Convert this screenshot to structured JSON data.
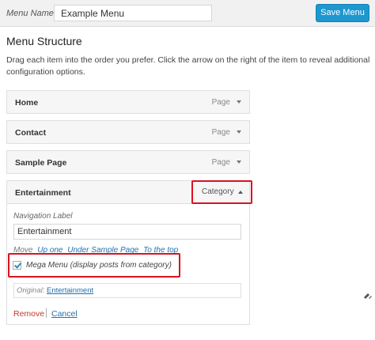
{
  "header": {
    "menu_name_label": "Menu Name",
    "menu_name_value": "Example Menu",
    "save_label": "Save Menu"
  },
  "structure": {
    "heading": "Menu Structure",
    "instructions": "Drag each item into the order you prefer. Click the arrow on the right of the item to reveal additional configuration options."
  },
  "items": [
    {
      "title": "Home",
      "type": "Page"
    },
    {
      "title": "Contact",
      "type": "Page"
    },
    {
      "title": "Sample Page",
      "type": "Page"
    },
    {
      "title": "Entertainment",
      "type": "Category"
    }
  ],
  "expanded": {
    "nav_label": "Navigation Label",
    "nav_value": "Entertainment",
    "move_label": "Move",
    "move_links": [
      "Up one",
      "Under Sample Page",
      "To the top"
    ],
    "mega_menu_label": "Mega Menu (display posts from category)",
    "mega_menu_checked": true,
    "original_label": "Original:",
    "original_link": "Entertainment",
    "remove_label": "Remove",
    "cancel_label": "Cancel"
  },
  "colors": {
    "accent": "#1e97cf",
    "highlight": "#d9131e",
    "link": "#2271b1"
  }
}
